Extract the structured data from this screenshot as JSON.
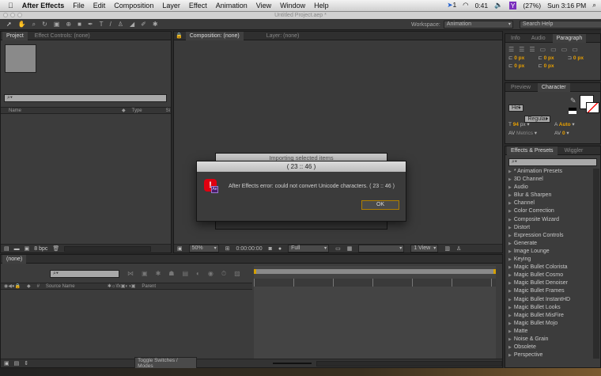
{
  "menubar": {
    "apple": "",
    "app": "After Effects",
    "items": [
      "File",
      "Edit",
      "Composition",
      "Layer",
      "Effect",
      "Animation",
      "View",
      "Window",
      "Help"
    ],
    "status": {
      "bluetooth_count": "1",
      "timer": "0:41",
      "battery": "(27%)",
      "clock": "Sun 3:16 PM"
    }
  },
  "titlebar": {
    "title": "Untitled Project.aep *"
  },
  "toolbar": {
    "workspace_label": "Workspace:",
    "workspace_value": "Animation",
    "search_placeholder": "Search Help"
  },
  "project_panel": {
    "tabs": [
      "Project",
      "Effect Controls: (none)"
    ],
    "col_name": "Name",
    "col_type": "Type",
    "col_size": "Si",
    "bpc": "8 bpc"
  },
  "comp_panel": {
    "tabs": [
      "Composition: (none)",
      "Layer: (none)"
    ],
    "zoom": "50%",
    "timecode": "0:00:00:00",
    "resolution": "Full",
    "view": "1 View"
  },
  "paragraph_panel": {
    "tabs": [
      "Info",
      "Audio",
      "Paragraph"
    ],
    "values": [
      "0 px",
      "0 px",
      "0 px",
      "0 px",
      "0 px"
    ]
  },
  "character_panel": {
    "tabs": [
      "Preview",
      "Character"
    ],
    "font": "Hel",
    "style": "Regular",
    "size": "94",
    "size_unit": "px",
    "leading": "Auto",
    "kerning": "Metrics",
    "tracking": "0"
  },
  "effects_panel": {
    "tabs": [
      "Effects & Presets",
      "Wiggler"
    ],
    "items": [
      "* Animation Presets",
      "3D Channel",
      "Audio",
      "Blur & Sharpen",
      "Channel",
      "Color Correction",
      "Composite Wizard",
      "Distort",
      "Expression Controls",
      "Generate",
      "Image Lounge",
      "Keying",
      "Magic Bullet Colorista",
      "Magic Bullet Cosmo",
      "Magic Bullet Denoiser",
      "Magic Bullet Frames",
      "Magic Bullet InstantHD",
      "Magic Bullet Looks",
      "Magic Bullet MisFire",
      "Magic Bullet Mojo",
      "Matte",
      "Noise & Grain",
      "Obsolete",
      "Perspective"
    ]
  },
  "timeline": {
    "tab": "(none)",
    "col_hash": "#",
    "col_source": "Source Name",
    "col_parent": "Parent",
    "toggle": "Toggle Switches / Modes"
  },
  "background_dialog": {
    "title": "Importing selected items"
  },
  "dialog": {
    "title": "( 23 :: 46 )",
    "message": "After Effects error: could not convert Unicode characters. ( 23 :: 46 )",
    "ok": "OK",
    "badge": "Ae"
  }
}
